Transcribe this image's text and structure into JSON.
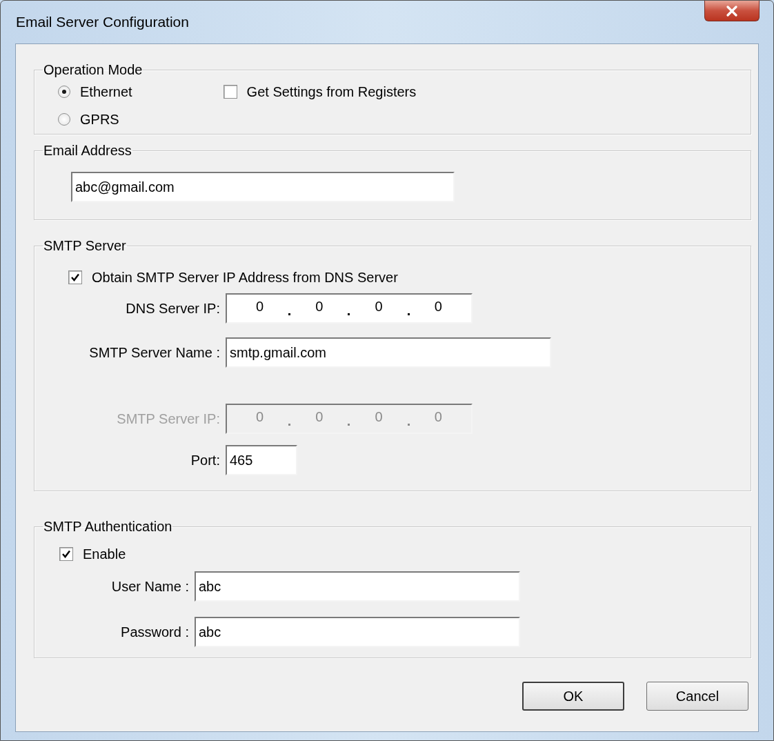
{
  "window": {
    "title": "Email Server Configuration"
  },
  "operation_mode": {
    "title": "Operation Mode",
    "options": [
      {
        "label": "Ethernet",
        "selected": true
      },
      {
        "label": "GPRS",
        "selected": false
      }
    ],
    "get_settings": {
      "label": "Get Settings from Registers",
      "checked": false
    }
  },
  "email_address": {
    "title": "Email Address",
    "value": "abc@gmail.com"
  },
  "smtp_server": {
    "title": "SMTP Server",
    "obtain_from_dns": {
      "label": "Obtain SMTP Server IP Address from DNS Server",
      "checked": true
    },
    "dns_server_ip": {
      "label": "DNS Server IP:",
      "octets": [
        "0",
        "0",
        "0",
        "0"
      ],
      "disabled": false
    },
    "server_name": {
      "label": "SMTP Server Name :",
      "value": "smtp.gmail.com"
    },
    "server_ip": {
      "label": "SMTP Server IP:",
      "octets": [
        "0",
        "0",
        "0",
        "0"
      ],
      "disabled": true
    },
    "port": {
      "label": "Port:",
      "value": "465"
    }
  },
  "smtp_authentication": {
    "title": "SMTP Authentication",
    "enable": {
      "label": "Enable",
      "checked": true
    },
    "user_name": {
      "label": "User Name :",
      "value": "abc"
    },
    "password": {
      "label": "Password :",
      "value": "abc"
    }
  },
  "buttons": [
    {
      "label": "OK",
      "default": true
    },
    {
      "label": "Cancel",
      "default": false
    }
  ]
}
